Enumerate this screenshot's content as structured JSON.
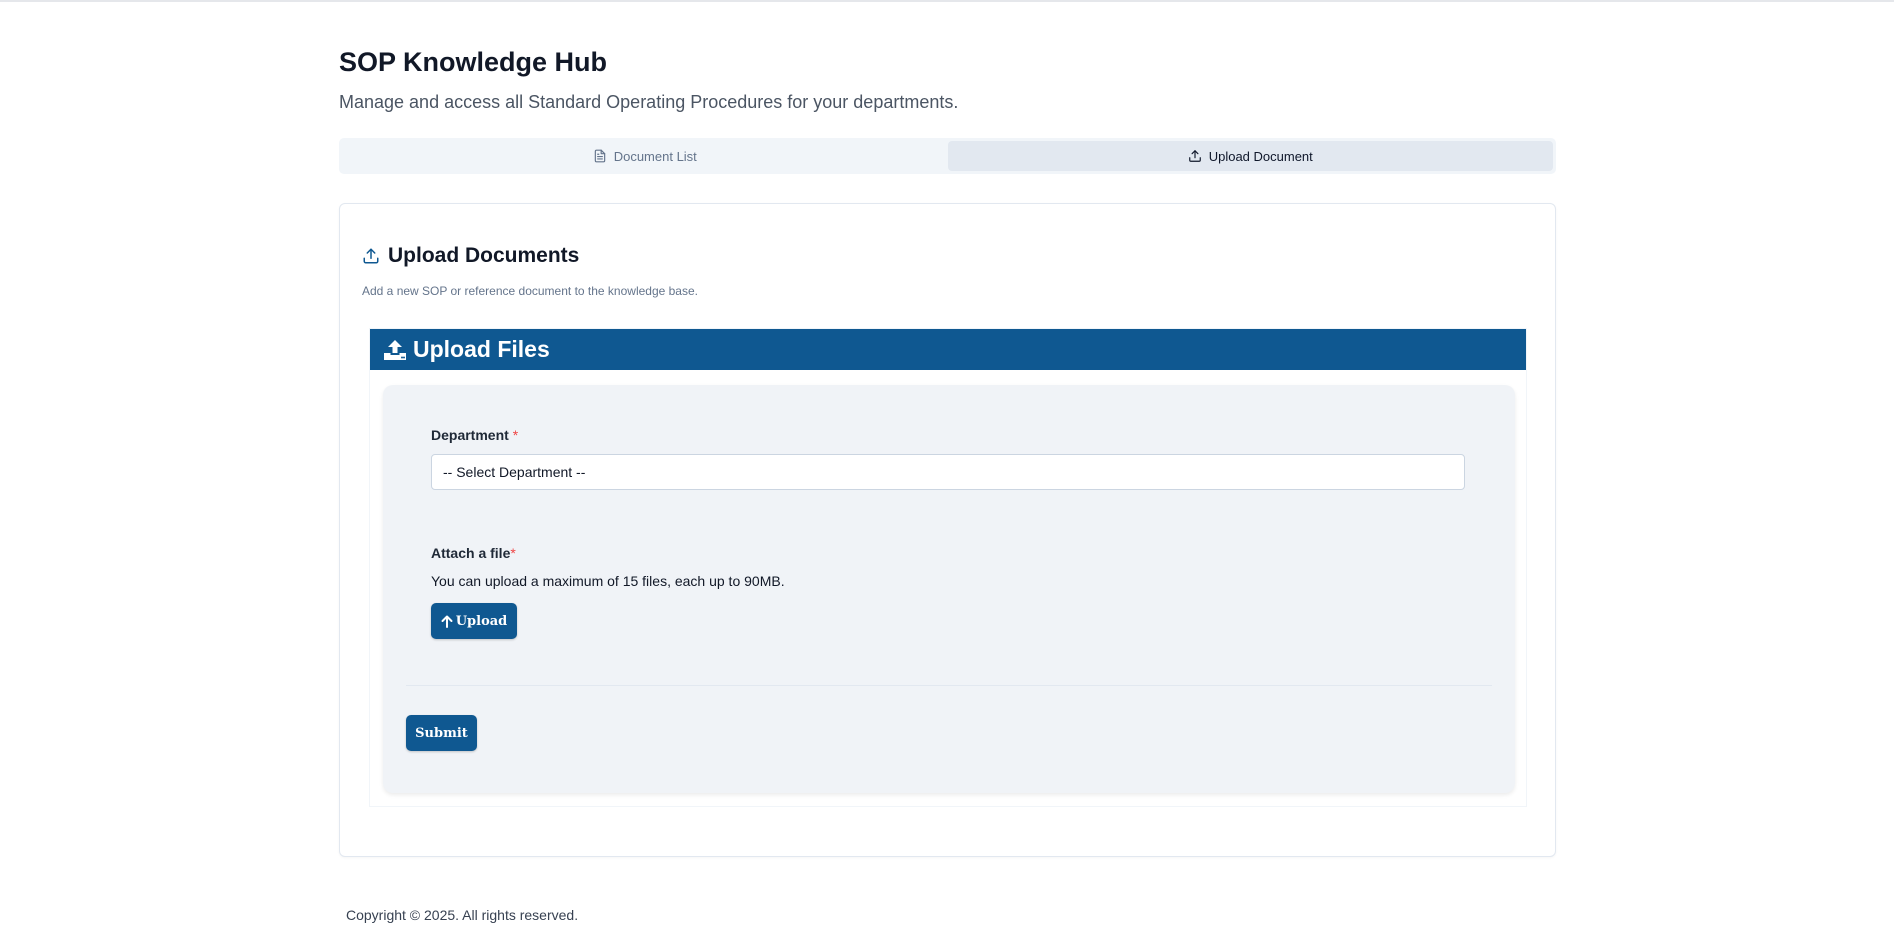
{
  "header": {
    "title": "SOP Knowledge Hub",
    "subtitle": "Manage and access all Standard Operating Procedures for your departments."
  },
  "tabs": [
    {
      "label": "Document List",
      "icon": "file-text-icon",
      "active": false
    },
    {
      "label": "Upload Document",
      "icon": "upload-icon",
      "active": true
    }
  ],
  "card": {
    "title": "Upload Documents",
    "description": "Add a new SOP or reference document to the knowledge base."
  },
  "panel": {
    "header": "Upload Files"
  },
  "form": {
    "department_label": "Department",
    "department_required": "*",
    "department_value": "-- Select Department --",
    "attach_label": "Attach a file",
    "attach_required": "*",
    "attach_help": "You can upload a maximum of 15 files, each up to 90MB.",
    "upload_button": "Upload",
    "submit_button": "Submit"
  },
  "footer": {
    "copyright": "Copyright © 2025. All rights reserved."
  },
  "colors": {
    "primary": "#0f5891",
    "required": "#ef4444",
    "form_bg": "#f0f3f7"
  }
}
